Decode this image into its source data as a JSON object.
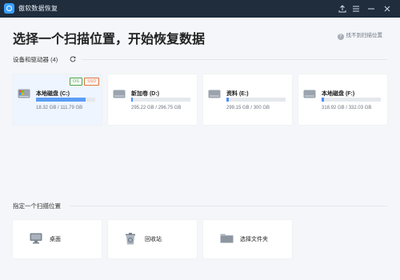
{
  "window": {
    "title": "傲软数据恢复"
  },
  "titlebar": {
    "buttons": [
      "upload-icon",
      "menu-icon",
      "minimize-icon",
      "close-icon"
    ]
  },
  "main": {
    "title": "选择一个扫描位置，开始恢复数据",
    "help_link": "找不到扫描位置"
  },
  "devices": {
    "section_title": "设备和驱动器 (4)",
    "drives": [
      {
        "name": "本地磁盘 (C:)",
        "size": "18.32 GB / 111.79 GB",
        "used_fraction": 0.84,
        "badges": [
          "OS",
          "SSD"
        ],
        "selected": true
      },
      {
        "name": "新加卷 (D:)",
        "size": "295.22 GB / 296.75 GB",
        "used_fraction": 0.03,
        "badges": [],
        "selected": false
      },
      {
        "name": "资料 (E:)",
        "size": "299.15 GB / 300 GB",
        "used_fraction": 0.04,
        "badges": [],
        "selected": false
      },
      {
        "name": "本地磁盘 (F:)",
        "size": "318.92 GB / 332.03 GB",
        "used_fraction": 0.04,
        "badges": [],
        "selected": false
      }
    ]
  },
  "locations": {
    "section_title": "指定一个扫描位置",
    "items": [
      {
        "label": "桌面",
        "icon": "desktop-icon"
      },
      {
        "label": "回收站",
        "icon": "recycle-bin-icon"
      },
      {
        "label": "选择文件夹",
        "icon": "folder-icon"
      }
    ]
  },
  "colors": {
    "titlebar": "#1f2d3d",
    "accent": "#4c8ef7",
    "os_badge": "#47a447",
    "ssd_badge": "#e2703a",
    "background": "#f4f6f9"
  }
}
